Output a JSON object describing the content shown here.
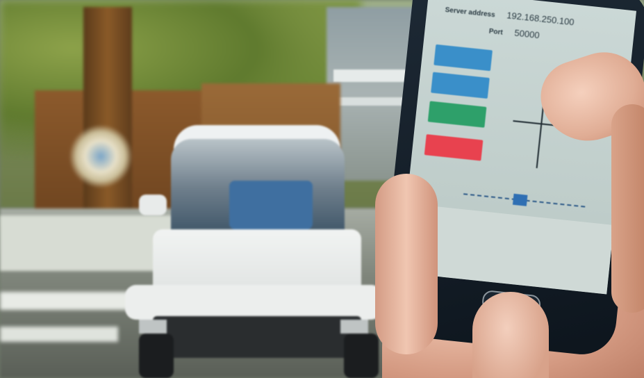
{
  "phone_app": {
    "server_address": {
      "label": "Server address",
      "value": "192.168.250.100"
    },
    "port": {
      "label": "Port",
      "value": "50000"
    },
    "buttons": [
      {
        "label": "",
        "color": "#3a8fc9"
      },
      {
        "label": "",
        "color": "#3a8fc9"
      },
      {
        "label": "",
        "color": "#2ea06a"
      },
      {
        "label": "",
        "color": "#e8424f"
      }
    ],
    "slider": {
      "value_fraction": 0.45
    }
  },
  "colors": {
    "vehicle": "#eef1f2",
    "button_blue": "#3a8fc9",
    "button_green": "#2ea06a",
    "button_red": "#e8424f",
    "slider_knob": "#2f6fb3"
  }
}
